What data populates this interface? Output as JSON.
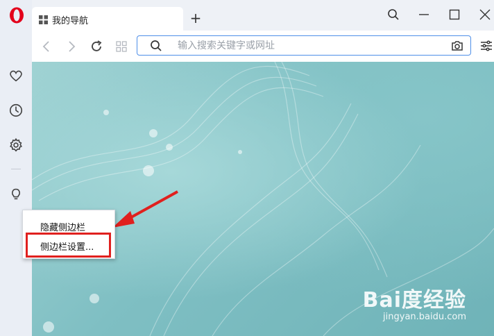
{
  "browser": {
    "tab": {
      "title": "我的导航"
    },
    "new_tab_label": "+",
    "address_bar": {
      "placeholder": "输入搜索关键字或网址",
      "value": ""
    }
  },
  "sidebar": {
    "icons": [
      "opera-logo",
      "heart-icon",
      "history-icon",
      "gear-icon",
      "lightbulb-icon"
    ]
  },
  "context_menu": {
    "items": [
      {
        "label": "隐藏侧边栏"
      },
      {
        "label": "侧边栏设置..."
      }
    ],
    "highlighted_index": 1
  },
  "watermark": {
    "brand": "Bai度经验",
    "site": "jingyan.baidu.com"
  },
  "colors": {
    "accent": "#4d8ee8",
    "highlight_red": "#e0201e",
    "opera_red": "#e3001b"
  }
}
